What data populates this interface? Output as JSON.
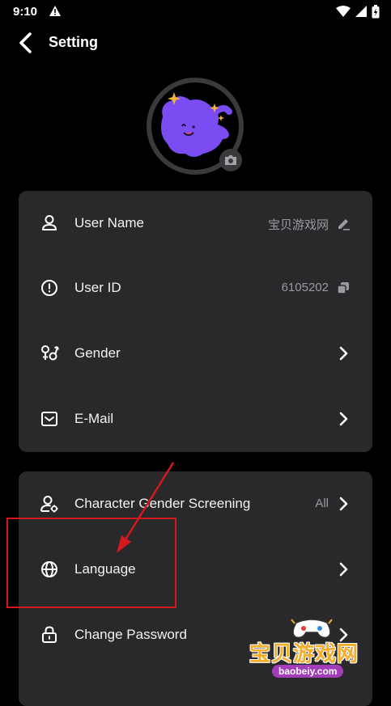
{
  "status_bar": {
    "time": "9:10"
  },
  "header": {
    "title": "Setting"
  },
  "profile_group": [
    {
      "name": "user-name",
      "label": "User Name",
      "value": "宝贝游戏网",
      "icon": "user-icon",
      "action_icon": "edit-icon"
    },
    {
      "name": "user-id",
      "label": "User ID",
      "value": "6105202",
      "icon": "id-icon",
      "action_icon": "copy-icon"
    },
    {
      "name": "gender",
      "label": "Gender",
      "value": "",
      "icon": "gender-icon",
      "action_icon": "chevron-right-icon"
    },
    {
      "name": "email",
      "label": "E-Mail",
      "value": "",
      "icon": "mail-icon",
      "action_icon": "chevron-right-icon"
    }
  ],
  "preferences_group": [
    {
      "name": "character-gender-screening",
      "label": "Character Gender Screening",
      "value": "All",
      "icon": "user-settings-icon",
      "action_icon": "chevron-right-icon"
    },
    {
      "name": "language",
      "label": "Language",
      "value": "",
      "icon": "globe-icon",
      "action_icon": "chevron-right-icon"
    },
    {
      "name": "change-password",
      "label": "Change Password",
      "value": "",
      "icon": "lock-icon",
      "action_icon": "chevron-right-icon"
    }
  ],
  "watermark": {
    "cn": "宝贝游戏网",
    "en": "baobeiy.com"
  },
  "colors": {
    "background": "#000000",
    "card": "#29292c",
    "avatar_purple": "#7a4cf2",
    "sparkle": "#f3b43a",
    "annotation": "#d4181d"
  }
}
